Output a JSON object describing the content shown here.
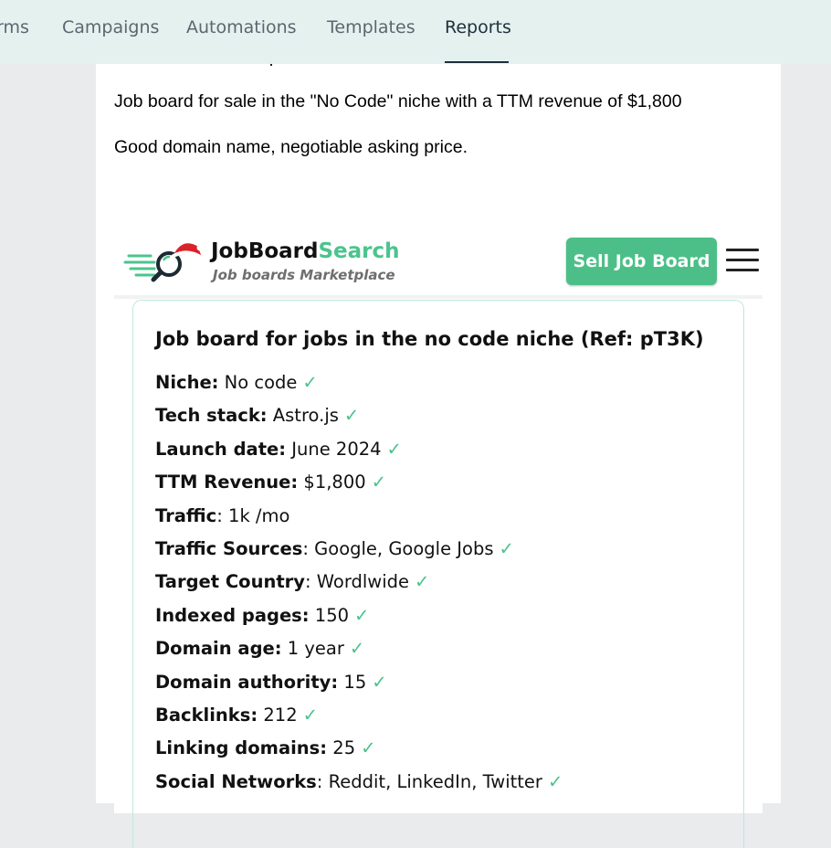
{
  "nav": {
    "tabs": [
      {
        "label": "rms"
      },
      {
        "label": "Campaigns"
      },
      {
        "label": "Automations"
      },
      {
        "label": "Templates"
      },
      {
        "label": "Reports"
      }
    ],
    "active_tab": "Reports"
  },
  "post": {
    "line1": "Job board for sale in the \"No Code\" niche with a TTM revenue of $1,800",
    "line2": "Good domain name, negotiable asking price."
  },
  "listing": {
    "brand_main": "JobBoard",
    "brand_accent": "Search",
    "tagline": "Job boards Marketplace",
    "sell_button": "Sell Job Board",
    "title": "Job board for jobs in the no code niche (Ref: pT3K)",
    "rows": [
      {
        "label": "Niche:",
        "sep": "",
        "value": "No code",
        "check": "✓"
      },
      {
        "label": "Tech stack:",
        "sep": "",
        "value": "Astro.js",
        "check": "✓"
      },
      {
        "label": "Launch date:",
        "sep": "",
        "value": "June 2024",
        "check": "✓"
      },
      {
        "label": "TTM Revenue:",
        "sep": "",
        "value": "$1,800",
        "check": "✓"
      },
      {
        "label": "Traffic",
        "sep": ":",
        "value": "1k /mo",
        "check": ""
      },
      {
        "label": "Traffic Sources",
        "sep": ":",
        "value": "Google, Google Jobs",
        "check": "✓"
      },
      {
        "label": "Target Country",
        "sep": ":",
        "value": "Wordlwide",
        "check": "✓"
      },
      {
        "label": "Indexed pages:",
        "sep": "",
        "value": "150",
        "check": "✓"
      },
      {
        "label": "Domain age:",
        "sep": "",
        "value": "1 year",
        "check": "✓"
      },
      {
        "label": "Domain authority:",
        "sep": "",
        "value": "15",
        "check": "✓"
      },
      {
        "label": "Backlinks:",
        "sep": "",
        "value": "212",
        "check": "✓"
      },
      {
        "label": "Linking domains:",
        "sep": "",
        "value": "25",
        "check": "✓"
      },
      {
        "label": "Social Networks",
        "sep": ":",
        "value": "Reddit, LinkedIn, Twitter",
        "check": "✓"
      }
    ]
  },
  "colors": {
    "nav_bg": "#e4f1ef",
    "accent_green": "#4bc48d",
    "button_green": "#4cbf88",
    "page_bg": "#e9ebed"
  }
}
